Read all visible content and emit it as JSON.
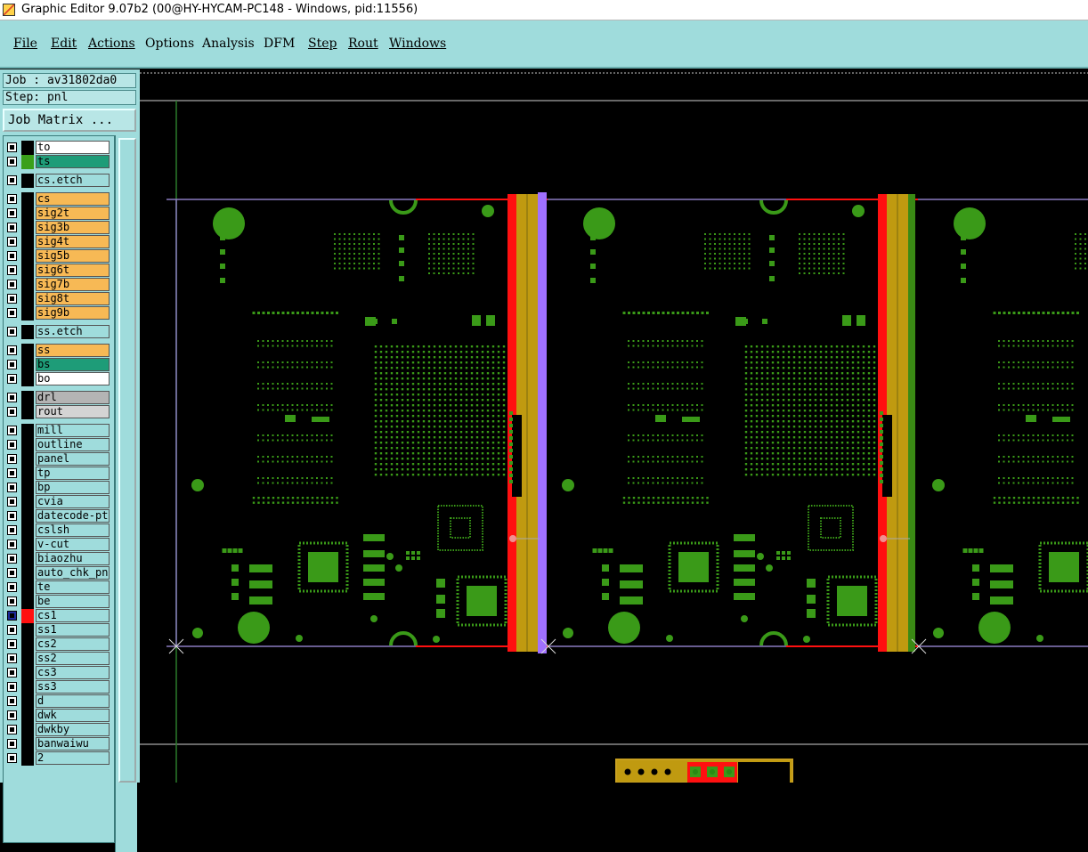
{
  "window": {
    "title": "Graphic Editor 9.07b2 (00@HY-HYCAM-PC148 - Windows, pid:11556)"
  },
  "menu": [
    {
      "label": "File"
    },
    {
      "label": "Edit"
    },
    {
      "label": "Actions"
    },
    {
      "label": "Options"
    },
    {
      "label": "Analysis"
    },
    {
      "label": "DFM"
    },
    {
      "label": "Step"
    },
    {
      "label": "Rout"
    },
    {
      "label": "Windows"
    }
  ],
  "job": {
    "job_label": "Job : av31802da0",
    "step_label": "Step: pnl",
    "matrix_button": "Job Matrix ..."
  },
  "layers": [
    {
      "name": "to",
      "color": "#ffffff",
      "swatch": "#000000"
    },
    {
      "name": "ts",
      "color": "#1e9c78",
      "swatch": "#3aa01a"
    },
    {
      "name": "cs.etch",
      "color": "#9fdcdc",
      "swatch": "#000000"
    },
    {
      "name": "cs",
      "color": "#f7b955",
      "swatch": "#000000"
    },
    {
      "name": "sig2t",
      "color": "#f7b955",
      "swatch": "#000000"
    },
    {
      "name": "sig3b",
      "color": "#f7b955",
      "swatch": "#000000"
    },
    {
      "name": "sig4t",
      "color": "#f7b955",
      "swatch": "#000000"
    },
    {
      "name": "sig5b",
      "color": "#f7b955",
      "swatch": "#000000"
    },
    {
      "name": "sig6t",
      "color": "#f7b955",
      "swatch": "#000000"
    },
    {
      "name": "sig7b",
      "color": "#f7b955",
      "swatch": "#000000"
    },
    {
      "name": "sig8t",
      "color": "#f7b955",
      "swatch": "#000000"
    },
    {
      "name": "sig9b",
      "color": "#f7b955",
      "swatch": "#000000"
    },
    {
      "name": "ss.etch",
      "color": "#9fdcdc",
      "swatch": "#000000"
    },
    {
      "name": "ss",
      "color": "#f7b955",
      "swatch": "#000000"
    },
    {
      "name": "bs",
      "color": "#1e9c78",
      "swatch": "#000000"
    },
    {
      "name": "bo",
      "color": "#ffffff",
      "swatch": "#000000"
    },
    {
      "name": "drl",
      "color": "#b4b4b4",
      "swatch": "#000000"
    },
    {
      "name": "rout",
      "color": "#d4d4d4",
      "swatch": "#000000"
    },
    {
      "name": "mill",
      "color": "#9fdcdc",
      "swatch": "#000000"
    },
    {
      "name": "outline",
      "color": "#9fdcdc",
      "swatch": "#000000"
    },
    {
      "name": "panel",
      "color": "#9fdcdc",
      "swatch": "#000000"
    },
    {
      "name": "tp",
      "color": "#9fdcdc",
      "swatch": "#000000"
    },
    {
      "name": "bp",
      "color": "#9fdcdc",
      "swatch": "#000000"
    },
    {
      "name": "cvia",
      "color": "#9fdcdc",
      "swatch": "#000000"
    },
    {
      "name": "datecode-pto",
      "color": "#9fdcdc",
      "swatch": "#000000"
    },
    {
      "name": "cslsh",
      "color": "#9fdcdc",
      "swatch": "#000000"
    },
    {
      "name": "v-cut",
      "color": "#9fdcdc",
      "swatch": "#000000"
    },
    {
      "name": "biaozhu",
      "color": "#9fdcdc",
      "swatch": "#000000"
    },
    {
      "name": "auto_chk_pnl",
      "color": "#9fdcdc",
      "swatch": "#000000"
    },
    {
      "name": "te",
      "color": "#9fdcdc",
      "swatch": "#000000"
    },
    {
      "name": "be",
      "color": "#9fdcdc",
      "swatch": "#000000"
    },
    {
      "name": "cs1",
      "color": "#9fdcdc",
      "swatch": "#ff1010",
      "active": true
    },
    {
      "name": "ss1",
      "color": "#9fdcdc",
      "swatch": "#000000"
    },
    {
      "name": "cs2",
      "color": "#9fdcdc",
      "swatch": "#000000"
    },
    {
      "name": "ss2",
      "color": "#9fdcdc",
      "swatch": "#000000"
    },
    {
      "name": "cs3",
      "color": "#9fdcdc",
      "swatch": "#000000"
    },
    {
      "name": "ss3",
      "color": "#9fdcdc",
      "swatch": "#000000"
    },
    {
      "name": "d",
      "color": "#9fdcdc",
      "swatch": "#000000"
    },
    {
      "name": "dwk",
      "color": "#9fdcdc",
      "swatch": "#000000"
    },
    {
      "name": "dwkby",
      "color": "#9fdcdc",
      "swatch": "#000000"
    },
    {
      "name": "banwaiwu",
      "color": "#9fdcdc",
      "swatch": "#000000"
    },
    {
      "name": "2",
      "color": "#9fdcdc",
      "swatch": "#000000"
    }
  ],
  "colors": {
    "pcb_green": "#3a9a18",
    "route_red": "#ff1010",
    "tooling_gold": "#c09a10",
    "separator_violet": "#a070ff",
    "outline_gray": "#8a8a8a"
  }
}
